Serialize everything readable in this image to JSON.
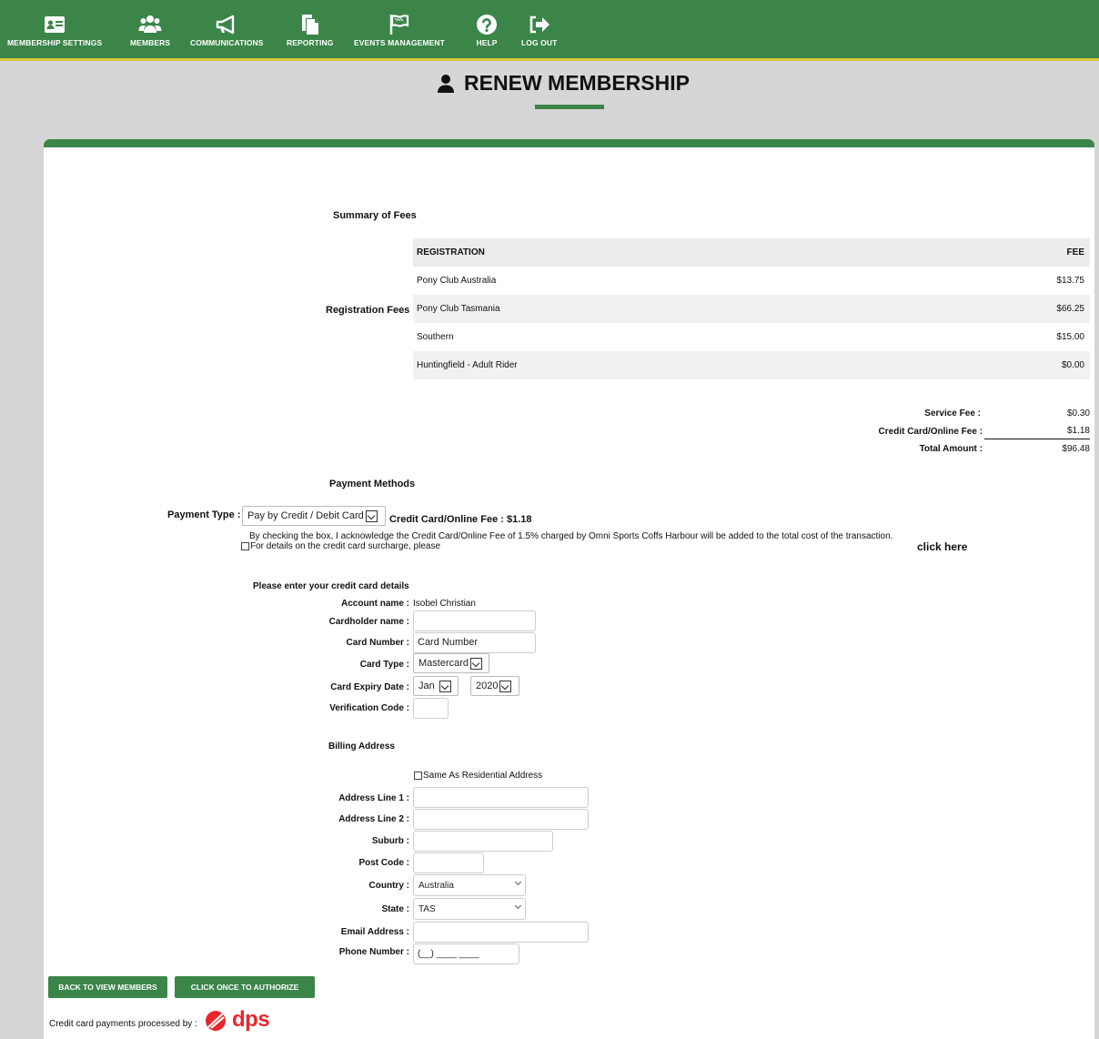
{
  "nav": {
    "items": [
      {
        "label": "MEMBERSHIP SETTINGS"
      },
      {
        "label": "MEMBERS"
      },
      {
        "label": "COMMUNICATIONS"
      },
      {
        "label": "REPORTING"
      },
      {
        "label": "EVENTS MANAGEMENT"
      },
      {
        "label": "HELP"
      },
      {
        "label": "LOG OUT"
      }
    ]
  },
  "page": {
    "title": "RENEW MEMBERSHIP"
  },
  "fees": {
    "section_title": "Summary of Fees",
    "registration_label": "Registration Fees :",
    "header": {
      "registration": "REGISTRATION",
      "fee": "FEE"
    },
    "rows": [
      {
        "name": "Pony Club Australia",
        "fee": "$13.75"
      },
      {
        "name": "Pony Club Tasmania",
        "fee": "$66.25"
      },
      {
        "name": "Southern",
        "fee": "$15.00"
      },
      {
        "name": "Huntingfield - Adult Rider",
        "fee": "$0.00"
      }
    ],
    "service_fee_label": "Service Fee :",
    "service_fee": "$0.30",
    "cc_fee_label": "Credit Card/Online Fee :",
    "cc_fee": "$1.18",
    "total_label": "Total Amount :",
    "total": "$96.48"
  },
  "payment": {
    "section_title": "Payment Methods",
    "type_label": "Payment Type :",
    "type_value": "Pay by Credit / Debit Card",
    "fee_note": "Credit Card/Online Fee : $1.18",
    "ack_text": "By checking the box, I acknowledge the Credit Card/Online Fee of 1.5% charged by Omni Sports Coffs Harbour will be added to the total cost of the transaction.",
    "details_text": "For details on the credit card surcharge, please",
    "click_here": "click here"
  },
  "card": {
    "section_title": "Please enter your credit card details",
    "account_label": "Account name :",
    "account_value": "Isobel Christian",
    "holder_label": "Cardholder name :",
    "holder_value": "",
    "number_label": "Card Number :",
    "number_placeholder": "Card Number",
    "type_label": "Card Type :",
    "type_value": "Mastercard",
    "expiry_label": "Card Expiry Date :",
    "expiry_month": "Jan",
    "expiry_year": "2020",
    "cvv_label": "Verification Code :"
  },
  "billing": {
    "section_title": "Billing Address",
    "same_as_label": "Same As Residential Address",
    "address1_label": "Address Line 1 :",
    "address2_label": "Address Line 2 :",
    "suburb_label": "Suburb :",
    "postcode_label": "Post Code :",
    "country_label": "Country :",
    "country_value": "Australia",
    "state_label": "State :",
    "state_value": "TAS",
    "email_label": "Email Address :",
    "phone_label": "Phone Number :",
    "phone_placeholder": "(__) ____ ____"
  },
  "buttons": {
    "back": "BACK TO VIEW MEMBERS",
    "authorize": "CLICK ONCE TO AUTHORIZE"
  },
  "footer": {
    "processed_by": "Credit card payments processed by :",
    "logo_text": "dps"
  },
  "colors": {
    "brand_green": "#3b8549",
    "accent_yellow": "#d8c43a",
    "dps_red": "#e8262b"
  }
}
